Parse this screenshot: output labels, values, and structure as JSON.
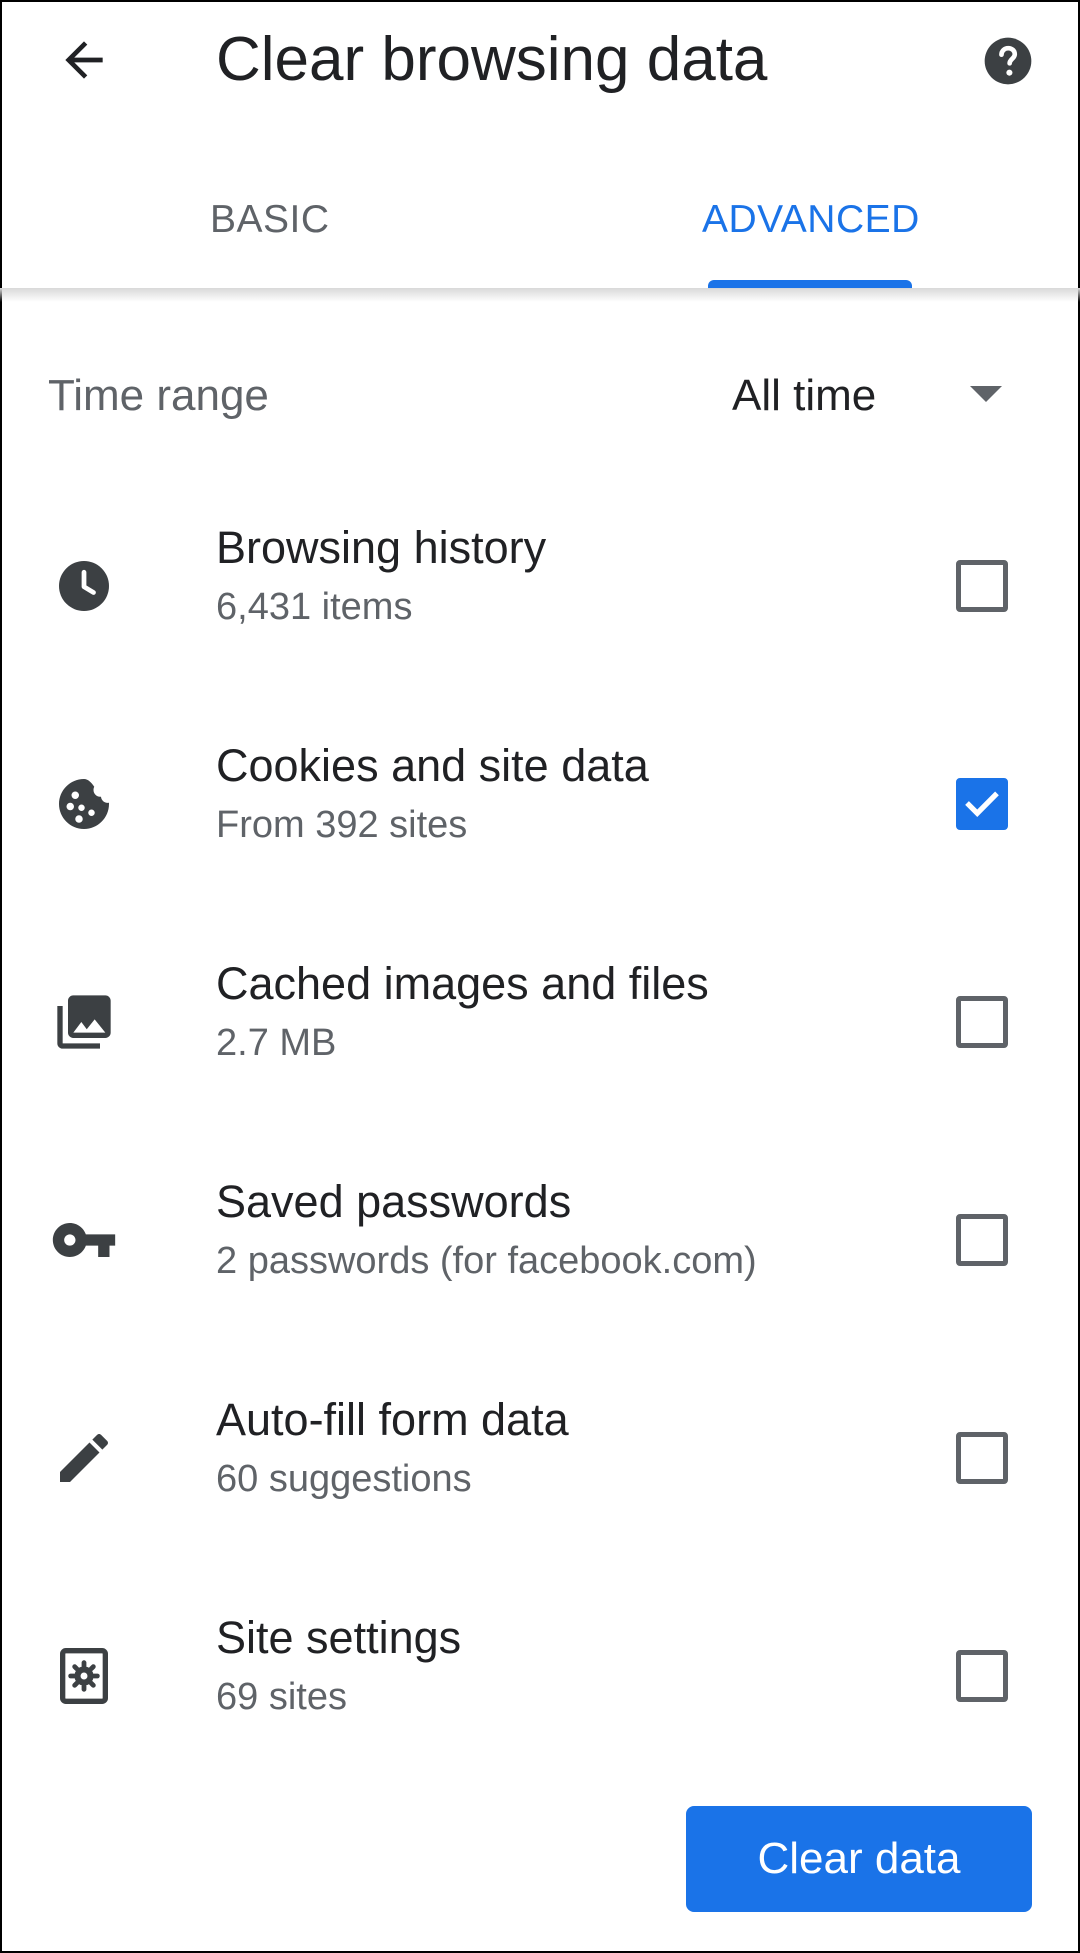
{
  "header": {
    "title": "Clear browsing data",
    "back_icon": "arrow-back-icon",
    "help_icon": "help-icon"
  },
  "tabs": [
    {
      "label": "BASIC",
      "selected": false
    },
    {
      "label": "ADVANCED",
      "selected": true
    }
  ],
  "time_range": {
    "label": "Time range",
    "value": "All time"
  },
  "items": [
    {
      "title": "Browsing history",
      "subtitle": "6,431 items",
      "icon": "clock-icon",
      "checked": false
    },
    {
      "title": "Cookies and site data",
      "subtitle": "From 392 sites",
      "icon": "cookie-icon",
      "checked": true
    },
    {
      "title": "Cached images and files",
      "subtitle": "2.7 MB",
      "icon": "images-icon",
      "checked": false
    },
    {
      "title": "Saved passwords",
      "subtitle": "2 passwords (for facebook.com)",
      "icon": "key-icon",
      "checked": false
    },
    {
      "title": "Auto-fill form data",
      "subtitle": "60 suggestions",
      "icon": "pencil-icon",
      "checked": false
    },
    {
      "title": "Site settings",
      "subtitle": "69 sites",
      "icon": "site-settings-icon",
      "checked": false
    }
  ],
  "action": {
    "clear_label": "Clear data"
  },
  "colors": {
    "accent": "#1a73e8",
    "text_primary": "#202124",
    "text_secondary": "#5f6368",
    "icon": "#3c4043"
  }
}
